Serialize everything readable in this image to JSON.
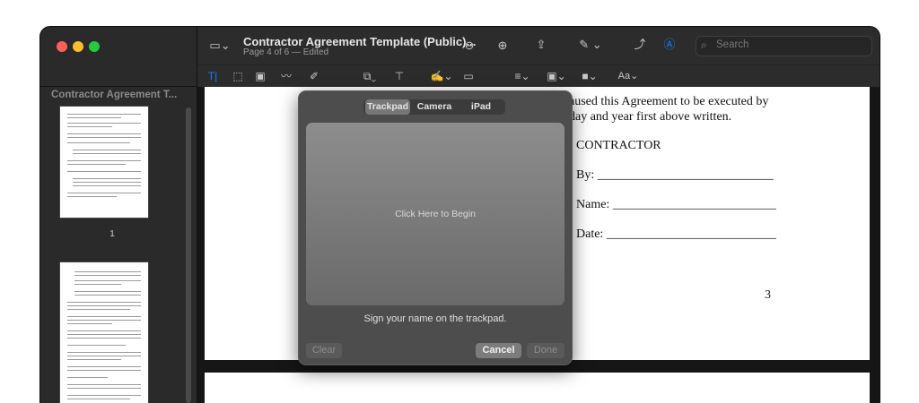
{
  "window": {
    "title": "Contractor Agreement Template (Public)...",
    "subtitle": "Page 4 of 6 — Edited"
  },
  "sidebar": {
    "title": "Contractor Agreement T...",
    "thumbnails": [
      {
        "page_label": "1"
      },
      {
        "page_label": ""
      }
    ]
  },
  "toolbar": {
    "search_placeholder": "Search",
    "icons": [
      "sidebar-toggle-icon",
      "zoom-out-icon",
      "zoom-in-icon",
      "share-icon",
      "markup-icon",
      "rotate-icon",
      "markup-circle-icon",
      "search-icon"
    ]
  },
  "markup_toolbar": {
    "icons": [
      "text-selection-icon",
      "rect-selection-icon",
      "redact-icon",
      "sketch-icon",
      "draw-icon",
      "shapes-icon",
      "text-box-icon",
      "sign-icon",
      "note-icon",
      "line-style-icon",
      "border-color-icon",
      "fill-color-icon",
      "text-style-icon"
    ],
    "text_style_label": "Aa"
  },
  "document": {
    "line1": "aused this Agreement to be executed by",
    "line2": "day and year first above written.",
    "party": "CONTRACTOR",
    "by_label": "By: ____________________________",
    "name_label": "Name: __________________________",
    "date_label": "Date: ___________________________",
    "page_number": "3"
  },
  "signature_sheet": {
    "tabs": [
      {
        "label": "Trackpad",
        "selected": true
      },
      {
        "label": "Camera",
        "selected": false
      },
      {
        "label": "iPad",
        "selected": false
      }
    ],
    "pad_prompt": "Click Here to Begin",
    "instruction": "Sign your name on the trackpad.",
    "clear_label": "Clear",
    "cancel_label": "Cancel",
    "done_label": "Done"
  },
  "colors": {
    "accent": "#0a84ff",
    "close": "#ff5f57",
    "minimize": "#febc2e",
    "zoom": "#28c840"
  }
}
